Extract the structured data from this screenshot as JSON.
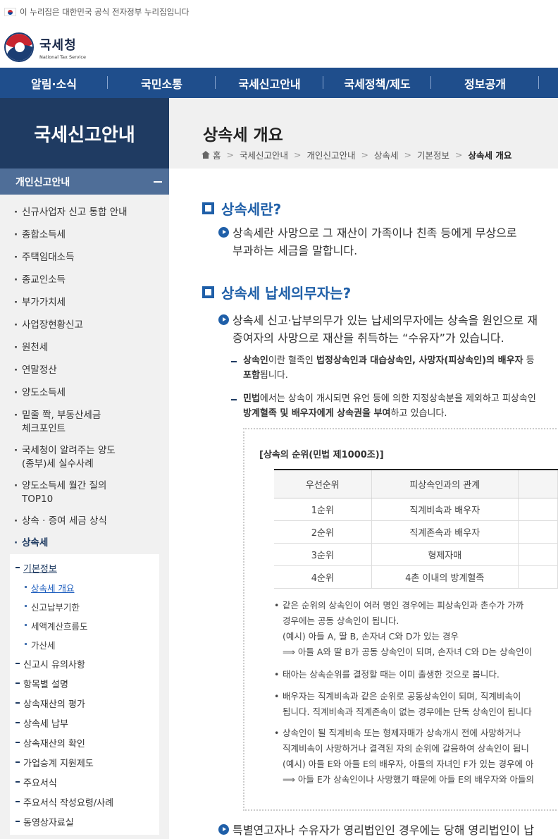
{
  "gov_banner": {
    "text": "이 누리집은 대한민국 공식 전자정부 누리집입니다"
  },
  "brand": {
    "name_ko": "국세청",
    "name_en": "National Tax Service"
  },
  "gnb": [
    "알림·소식",
    "국민소통",
    "국세신고안내",
    "국세정책/제도",
    "정보공개"
  ],
  "lnb": {
    "title": "국세신고안내",
    "subtitle": "개인신고안내",
    "items": [
      "신규사업자 신고 통합 안내",
      "종합소득세",
      "주택임대소득",
      "종교인소득",
      "부가가치세",
      "사업장현황신고",
      "원천세",
      "연말정산",
      "양도소득세",
      "밑줄 쫙, 부동산세금",
      "체크포인트",
      "국세청이 알려주는 양도",
      "(종부)세 실수사례",
      "양도소득세 월간 질의",
      "TOP10",
      "상속 · 증여 세금 상식",
      "상속세"
    ],
    "level3": [
      "기본정보",
      "신고시 유의사항",
      "항목별 설명",
      "상속재산의 평가",
      "상속세 납부",
      "상속재산의 확인",
      "가업승계 지원제도",
      "주요서식",
      "주요서식 작성요령/사례",
      "동영상자료실"
    ],
    "level4": [
      "상속세 개요",
      "신고납부기한",
      "세액계산흐름도",
      "가산세"
    ]
  },
  "page": {
    "title": "상속세 개요",
    "breadcrumb": [
      "홈",
      "국세신고안내",
      "개인신고안내",
      "상속세",
      "기본정보",
      "상속세 개요"
    ]
  },
  "sections": {
    "s1_title": "상속세란?",
    "s1_p1": "상속세란 사망으로 그 재산이 가족이나 친족 등에게 무상으로",
    "s1_p2": "부과하는 세금을 말합니다.",
    "s2_title": "상속세 납세의무자는?",
    "s2_p1": "상속세 신고·납부의무가 있는 납세의무자에는 상속을 원인으로 재",
    "s2_p2": "증여자의 사망으로 재산을 취득하는 “수유자”가 있습니다.",
    "d1_b1": "상속인",
    "d1_t1": "이란 혈족인 ",
    "d1_b2": "법정상속인과 대습상속인, 사망자(피상속인)의 배우자",
    "d1_t2": " 등",
    "d1_b3": "포함",
    "d1_t3": "됩니다.",
    "d2_b1": "민법",
    "d2_t1": "에서는 상속이 개시되면 유언 등에 의한 지정상속분을 제외하고 피상속인",
    "d2_b2": "방계혈족 및 배우자에게 상속권을 부여",
    "d2_t2": "하고 있습니다.",
    "bottom_para": "특별연고자나 수유자가 영리법인인 경우에는 당해 영리법인이 납"
  },
  "table": {
    "caption": "[상속의 순위(민법 제1000조)]",
    "headers": [
      "우선순위",
      "피상속인과의 관계"
    ],
    "rows": [
      [
        "1순위",
        "직계비속과 배우자"
      ],
      [
        "2순위",
        "직계존속과 배우자"
      ],
      [
        "3순위",
        "형제자매"
      ],
      [
        "4순위",
        "4촌 이내의 방계혈족"
      ]
    ]
  },
  "notes": {
    "n1_1": "같은 순위의 상속인이 여러 명인 경우에는 피상속인과 촌수가 가까",
    "n1_2": "경우에는 공동 상속인이 됩니다.",
    "n1_3": "(예시) 아들 A, 딸 B, 손자녀 C와 D가 있는 경우",
    "n1_4": "⟹ 아들 A와 딸 B가 공동 상속인이 되며, 손자녀 C와 D는 상속인이",
    "n2_1": "태아는 상속순위를 결정할 때는 이미 출생한 것으로 봅니다.",
    "n3_1": "배우자는 직계비속과 같은 순위로 공동상속인이 되며, 직계비속이",
    "n3_2": "됩니다. 직계비속과 직계존속이 없는 경우에는 단독 상속인이 됩니다",
    "n4_1": "상속인이 될 직계비속 또는 형제자매가 상속개시 전에 사망하거나",
    "n4_2": "직계비속이 사망하거나 결격된 자의 순위에 갈음하여 상속인이 됩니",
    "n4_3": "(예시) 아들 E와 아들 E의 배우자, 아들의 자녀인 F가 있는 경우에 아",
    "n4_4": "⟹ 아들 E가 상속인이나 사망했기 때문에 아들 E의 배우자와 아들의"
  }
}
